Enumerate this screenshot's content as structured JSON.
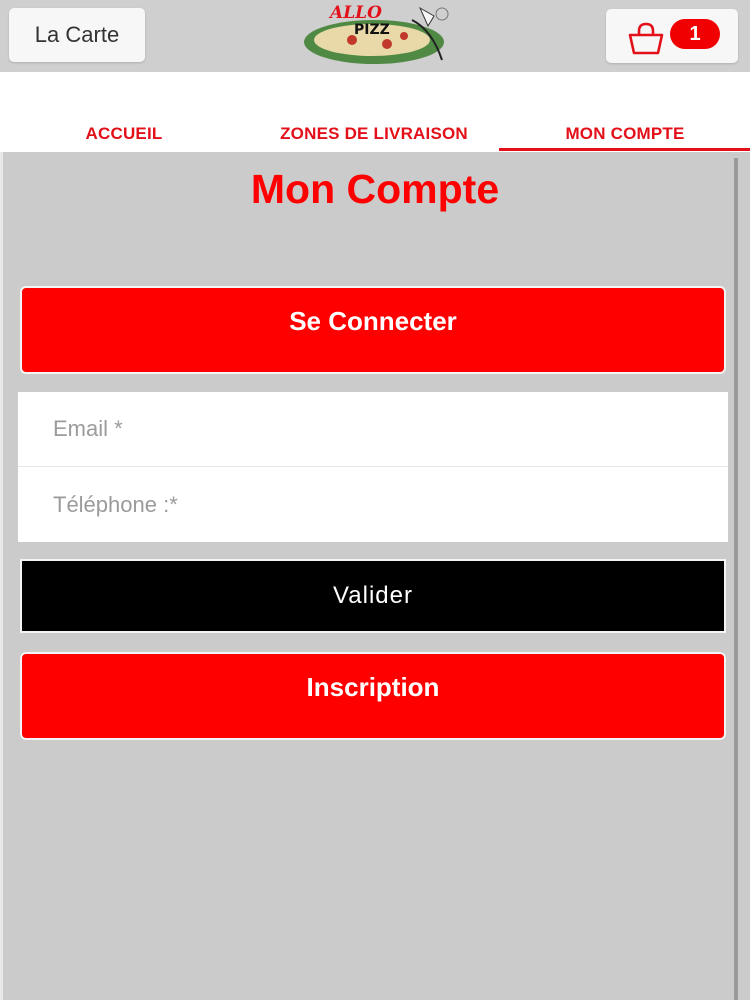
{
  "header": {
    "menu_label": "La Carte",
    "cart_count": "1",
    "logo_text": {
      "line1": "ALLO",
      "line2": "PIZZ"
    }
  },
  "nav": {
    "tabs": [
      {
        "label": "ACCUEIL"
      },
      {
        "label": "ZONES DE LIVRAISON"
      },
      {
        "label": "MON COMPTE",
        "active": true
      }
    ]
  },
  "main": {
    "title": "Mon Compte",
    "login_button": "Se Connecter",
    "email_placeholder": "Email *",
    "phone_placeholder": "Téléphone :*",
    "validate_button": "Valider",
    "signup_button": "Inscription"
  },
  "colors": {
    "accent": "#ff0000",
    "background": "#cbcbcb",
    "validate": "#000000"
  },
  "icons": [
    "shopping-bag-icon"
  ]
}
